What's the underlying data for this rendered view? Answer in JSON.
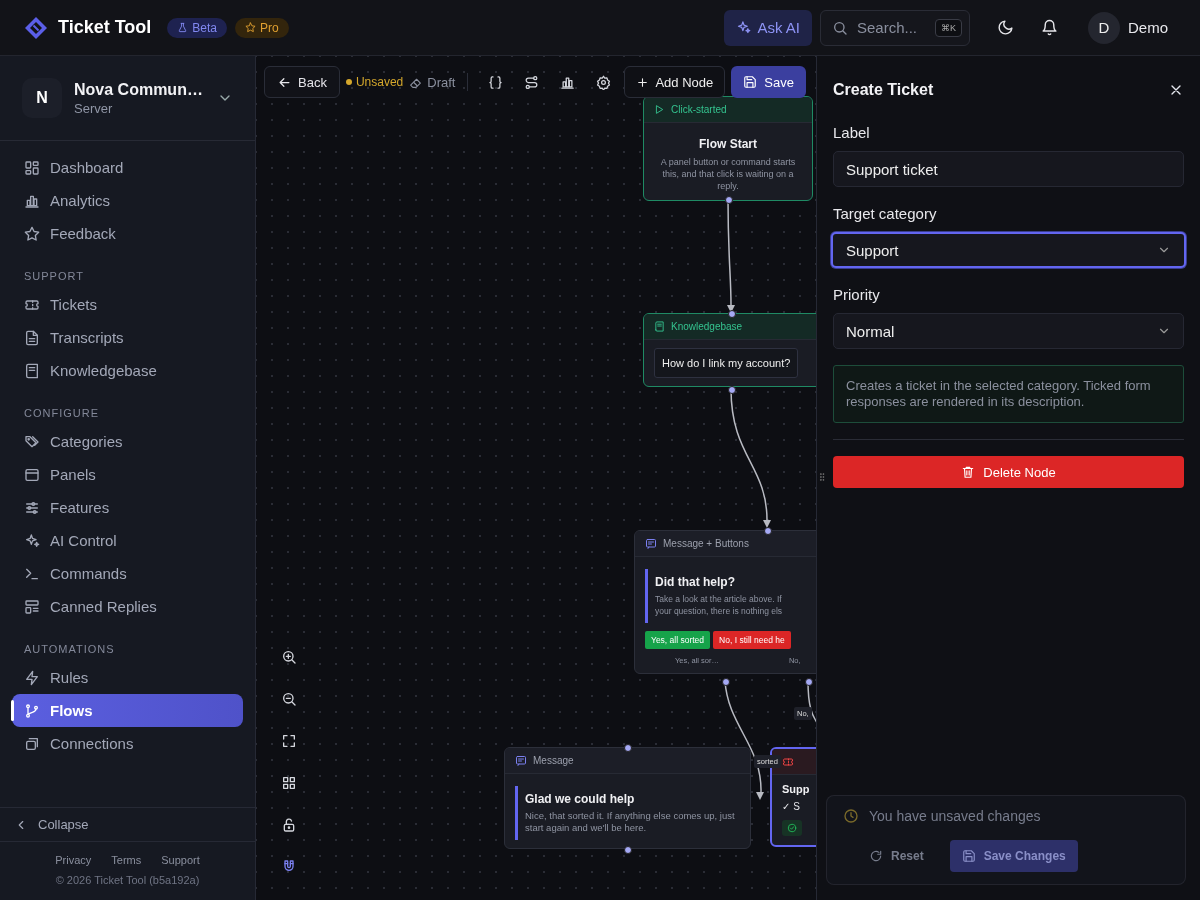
{
  "header": {
    "brand": "Ticket Tool",
    "badges": [
      {
        "label": "Beta",
        "kind": "beta"
      },
      {
        "label": "Pro",
        "kind": "pro"
      }
    ],
    "ask_ai": "Ask AI",
    "search": {
      "placeholder": "Search...",
      "shortcut": "⌘K"
    },
    "user": {
      "initial": "D",
      "name": "Demo"
    }
  },
  "sidebar": {
    "server": {
      "initial": "N",
      "name": "Nova Commun…",
      "subtitle": "Server"
    },
    "sections": [
      {
        "items": [
          {
            "label": "Dashboard",
            "selected": false
          },
          {
            "label": "Analytics",
            "selected": false
          },
          {
            "label": "Feedback",
            "selected": false
          }
        ]
      },
      {
        "title": "SUPPORT",
        "items": [
          {
            "label": "Tickets",
            "selected": false
          },
          {
            "label": "Transcripts",
            "selected": false
          },
          {
            "label": "Knowledgebase",
            "selected": false
          }
        ]
      },
      {
        "title": "CONFIGURE",
        "items": [
          {
            "label": "Categories",
            "selected": false
          },
          {
            "label": "Panels",
            "selected": false
          },
          {
            "label": "Features",
            "selected": false
          },
          {
            "label": "AI Control",
            "selected": false
          },
          {
            "label": "Commands",
            "selected": false
          },
          {
            "label": "Canned Replies",
            "selected": false
          }
        ]
      },
      {
        "title": "AUTOMATIONS",
        "items": [
          {
            "label": "Rules",
            "selected": false
          },
          {
            "label": "Flows",
            "selected": true
          },
          {
            "label": "Connections",
            "selected": false
          }
        ]
      }
    ],
    "collapse": "Collapse",
    "links": [
      "Privacy",
      "Terms",
      "Support"
    ],
    "copyright": "© 2026 Ticket Tool (b5a192a)"
  },
  "canvas": {
    "toolbar": {
      "back": "Back",
      "status": "Unsaved",
      "draft": "Draft",
      "add_node": "Add Node",
      "save": "Save"
    },
    "nodes": [
      {
        "kind": "trigger",
        "header": "Click-started",
        "title": "Flow Start",
        "description": "A panel button or command starts this, and that click is waiting on a reply.",
        "selected": false
      },
      {
        "kind": "knowledgebase",
        "header": "Knowledgebase",
        "question": "How do I link my account?",
        "selected": false
      },
      {
        "kind": "buttons",
        "header": "Message + Buttons",
        "title": "Did that help?",
        "text_lines": [
          "Take a look at the article above. If",
          "your question, there is nothing els"
        ],
        "buttons": [
          {
            "label": "Yes, all sorted",
            "color": "#16a34a"
          },
          {
            "label": "No, I still need he",
            "color": "#dc2626"
          }
        ],
        "outputs": [
          "Yes, all sor…",
          "No,"
        ],
        "selected": false
      },
      {
        "kind": "message",
        "header": "Message",
        "title": "Glad we could help",
        "text": "Nice, that sorted it. If anything else comes up, just start again and we'll be here.",
        "selected": false
      },
      {
        "kind": "ticket",
        "title": "Supp",
        "checklist": [
          "✓ S"
        ],
        "selected": true
      }
    ],
    "edge_labels": [
      "No,",
      "sorted"
    ],
    "controls": {
      "locked": false,
      "snap": true
    }
  },
  "panel": {
    "title": "Create Ticket",
    "fields": [
      {
        "label": "Label",
        "kind": "text",
        "value": "Support ticket",
        "focused": false
      },
      {
        "label": "Target category",
        "kind": "select",
        "value": "Support",
        "focused": true
      },
      {
        "label": "Priority",
        "kind": "select",
        "value": "Normal",
        "focused": false
      }
    ],
    "note": "Creates a ticket in the selected category. Ticked form responses are rendered in its description.",
    "delete": "Delete Node"
  },
  "toast": {
    "message": "You have unsaved changes",
    "reset": "Reset",
    "save": "Save Changes"
  }
}
